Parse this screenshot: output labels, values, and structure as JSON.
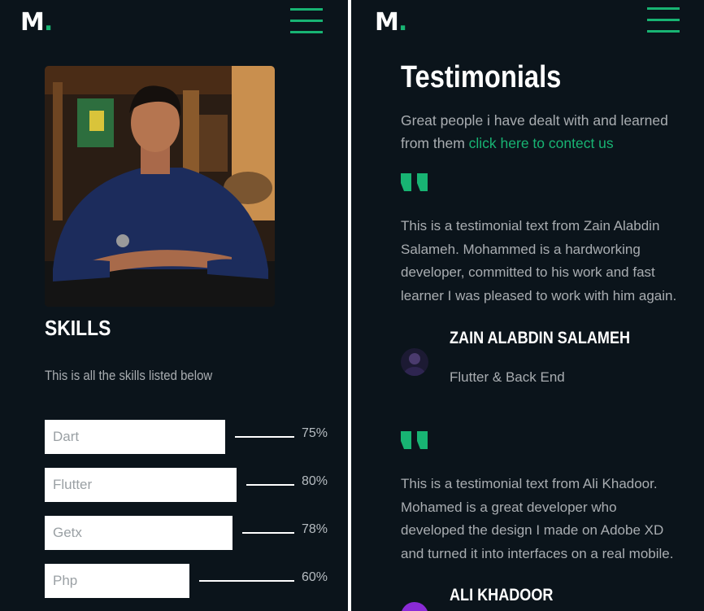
{
  "left": {
    "logo": {
      "letter": "M",
      "dot": "."
    },
    "photo_alt": "Profile photo",
    "skills": {
      "title": "SKILLS",
      "subtitle": "This is all the skills listed below",
      "items": [
        {
          "name": "Dart",
          "percent": "75%",
          "level": 0.75
        },
        {
          "name": "Flutter",
          "percent": "80%",
          "level": 0.8
        },
        {
          "name": "Getx",
          "percent": "78%",
          "level": 0.78
        },
        {
          "name": "Php",
          "percent": "60%",
          "level": 0.6
        }
      ]
    }
  },
  "right": {
    "logo": {
      "letter": "M",
      "dot": "."
    },
    "title": "Testimonials",
    "intro": "Great people i have dealt with and learned from them",
    "contact_link": "click here to contect us",
    "testimonials": [
      {
        "text": "This is a testimonial text from Zain Alabdin Salameh. Mohammed is a hardworking developer, committed to his work and fast learner I was pleased to work with him again.",
        "name": "ZAIN ALABDIN SALAMEH",
        "role": "Flutter & Back End"
      },
      {
        "text": "This is a testimonial text from Ali Khadoor. Mohamed is a great developer who developed the design I made on Adobe XD and turned it into interfaces on a real mobile.",
        "name": "ALI KHADOOR",
        "role": ""
      }
    ]
  },
  "colors": {
    "background": "#0b141b",
    "accent": "#18b473",
    "text_muted": "#a9adb1",
    "white": "#ffffff"
  },
  "icons": {
    "menu": "hamburger-menu-icon",
    "quote": "quote-mark-icon"
  }
}
